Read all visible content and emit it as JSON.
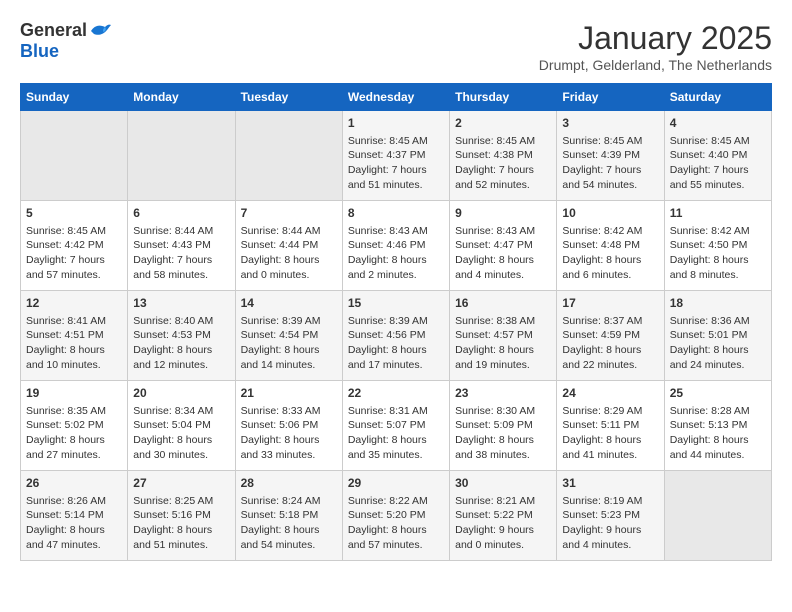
{
  "logo": {
    "general": "General",
    "blue": "Blue"
  },
  "title": "January 2025",
  "subtitle": "Drumpt, Gelderland, The Netherlands",
  "days_of_week": [
    "Sunday",
    "Monday",
    "Tuesday",
    "Wednesday",
    "Thursday",
    "Friday",
    "Saturday"
  ],
  "weeks": [
    [
      {
        "day": "",
        "info": ""
      },
      {
        "day": "",
        "info": ""
      },
      {
        "day": "",
        "info": ""
      },
      {
        "day": "1",
        "info": "Sunrise: 8:45 AM\nSunset: 4:37 PM\nDaylight: 7 hours\nand 51 minutes."
      },
      {
        "day": "2",
        "info": "Sunrise: 8:45 AM\nSunset: 4:38 PM\nDaylight: 7 hours\nand 52 minutes."
      },
      {
        "day": "3",
        "info": "Sunrise: 8:45 AM\nSunset: 4:39 PM\nDaylight: 7 hours\nand 54 minutes."
      },
      {
        "day": "4",
        "info": "Sunrise: 8:45 AM\nSunset: 4:40 PM\nDaylight: 7 hours\nand 55 minutes."
      }
    ],
    [
      {
        "day": "5",
        "info": "Sunrise: 8:45 AM\nSunset: 4:42 PM\nDaylight: 7 hours\nand 57 minutes."
      },
      {
        "day": "6",
        "info": "Sunrise: 8:44 AM\nSunset: 4:43 PM\nDaylight: 7 hours\nand 58 minutes."
      },
      {
        "day": "7",
        "info": "Sunrise: 8:44 AM\nSunset: 4:44 PM\nDaylight: 8 hours\nand 0 minutes."
      },
      {
        "day": "8",
        "info": "Sunrise: 8:43 AM\nSunset: 4:46 PM\nDaylight: 8 hours\nand 2 minutes."
      },
      {
        "day": "9",
        "info": "Sunrise: 8:43 AM\nSunset: 4:47 PM\nDaylight: 8 hours\nand 4 minutes."
      },
      {
        "day": "10",
        "info": "Sunrise: 8:42 AM\nSunset: 4:48 PM\nDaylight: 8 hours\nand 6 minutes."
      },
      {
        "day": "11",
        "info": "Sunrise: 8:42 AM\nSunset: 4:50 PM\nDaylight: 8 hours\nand 8 minutes."
      }
    ],
    [
      {
        "day": "12",
        "info": "Sunrise: 8:41 AM\nSunset: 4:51 PM\nDaylight: 8 hours\nand 10 minutes."
      },
      {
        "day": "13",
        "info": "Sunrise: 8:40 AM\nSunset: 4:53 PM\nDaylight: 8 hours\nand 12 minutes."
      },
      {
        "day": "14",
        "info": "Sunrise: 8:39 AM\nSunset: 4:54 PM\nDaylight: 8 hours\nand 14 minutes."
      },
      {
        "day": "15",
        "info": "Sunrise: 8:39 AM\nSunset: 4:56 PM\nDaylight: 8 hours\nand 17 minutes."
      },
      {
        "day": "16",
        "info": "Sunrise: 8:38 AM\nSunset: 4:57 PM\nDaylight: 8 hours\nand 19 minutes."
      },
      {
        "day": "17",
        "info": "Sunrise: 8:37 AM\nSunset: 4:59 PM\nDaylight: 8 hours\nand 22 minutes."
      },
      {
        "day": "18",
        "info": "Sunrise: 8:36 AM\nSunset: 5:01 PM\nDaylight: 8 hours\nand 24 minutes."
      }
    ],
    [
      {
        "day": "19",
        "info": "Sunrise: 8:35 AM\nSunset: 5:02 PM\nDaylight: 8 hours\nand 27 minutes."
      },
      {
        "day": "20",
        "info": "Sunrise: 8:34 AM\nSunset: 5:04 PM\nDaylight: 8 hours\nand 30 minutes."
      },
      {
        "day": "21",
        "info": "Sunrise: 8:33 AM\nSunset: 5:06 PM\nDaylight: 8 hours\nand 33 minutes."
      },
      {
        "day": "22",
        "info": "Sunrise: 8:31 AM\nSunset: 5:07 PM\nDaylight: 8 hours\nand 35 minutes."
      },
      {
        "day": "23",
        "info": "Sunrise: 8:30 AM\nSunset: 5:09 PM\nDaylight: 8 hours\nand 38 minutes."
      },
      {
        "day": "24",
        "info": "Sunrise: 8:29 AM\nSunset: 5:11 PM\nDaylight: 8 hours\nand 41 minutes."
      },
      {
        "day": "25",
        "info": "Sunrise: 8:28 AM\nSunset: 5:13 PM\nDaylight: 8 hours\nand 44 minutes."
      }
    ],
    [
      {
        "day": "26",
        "info": "Sunrise: 8:26 AM\nSunset: 5:14 PM\nDaylight: 8 hours\nand 47 minutes."
      },
      {
        "day": "27",
        "info": "Sunrise: 8:25 AM\nSunset: 5:16 PM\nDaylight: 8 hours\nand 51 minutes."
      },
      {
        "day": "28",
        "info": "Sunrise: 8:24 AM\nSunset: 5:18 PM\nDaylight: 8 hours\nand 54 minutes."
      },
      {
        "day": "29",
        "info": "Sunrise: 8:22 AM\nSunset: 5:20 PM\nDaylight: 8 hours\nand 57 minutes."
      },
      {
        "day": "30",
        "info": "Sunrise: 8:21 AM\nSunset: 5:22 PM\nDaylight: 9 hours\nand 0 minutes."
      },
      {
        "day": "31",
        "info": "Sunrise: 8:19 AM\nSunset: 5:23 PM\nDaylight: 9 hours\nand 4 minutes."
      },
      {
        "day": "",
        "info": ""
      }
    ]
  ]
}
